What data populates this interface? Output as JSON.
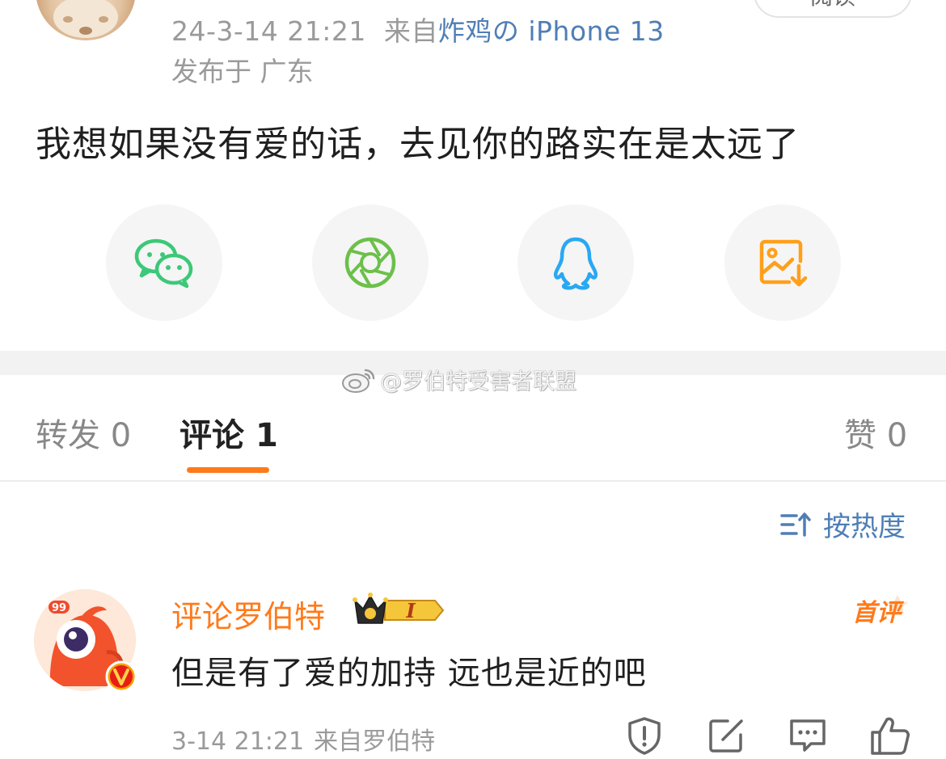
{
  "post": {
    "timestamp": "24-3-14 21:21",
    "source_prefix": "来自",
    "device": "炸鸡の iPhone 13",
    "location": "发布于 广东",
    "text": "我想如果没有爱的话，去见你的路实在是太远了",
    "read_label": "阅读"
  },
  "share": {
    "items": [
      {
        "icon": "wechat-icon",
        "color": "#3cc878"
      },
      {
        "icon": "moments-icon",
        "color": "#6cc04a"
      },
      {
        "icon": "qq-icon",
        "color": "#2aa8f2"
      },
      {
        "icon": "save-image-icon",
        "color": "#ff9f1a"
      }
    ]
  },
  "watermark": "@罗伯特受害者联盟",
  "tabs": {
    "repost_label": "转发",
    "repost_count": "0",
    "comment_label": "评论",
    "comment_count": "1",
    "like_label": "赞",
    "like_count": "0"
  },
  "sort": {
    "label": "按热度"
  },
  "comment": {
    "username": "评论罗伯特",
    "level": "I",
    "avatar_badge": "99",
    "first_badge": "首评",
    "text": "但是有了爱的加持 远也是近的吧",
    "time": "3-14 21:21",
    "source": "来自罗伯特"
  },
  "colors": {
    "accent_orange": "#ff7a1a",
    "link_blue": "#4f7eb5",
    "meta_gray": "#9a9a9a"
  }
}
